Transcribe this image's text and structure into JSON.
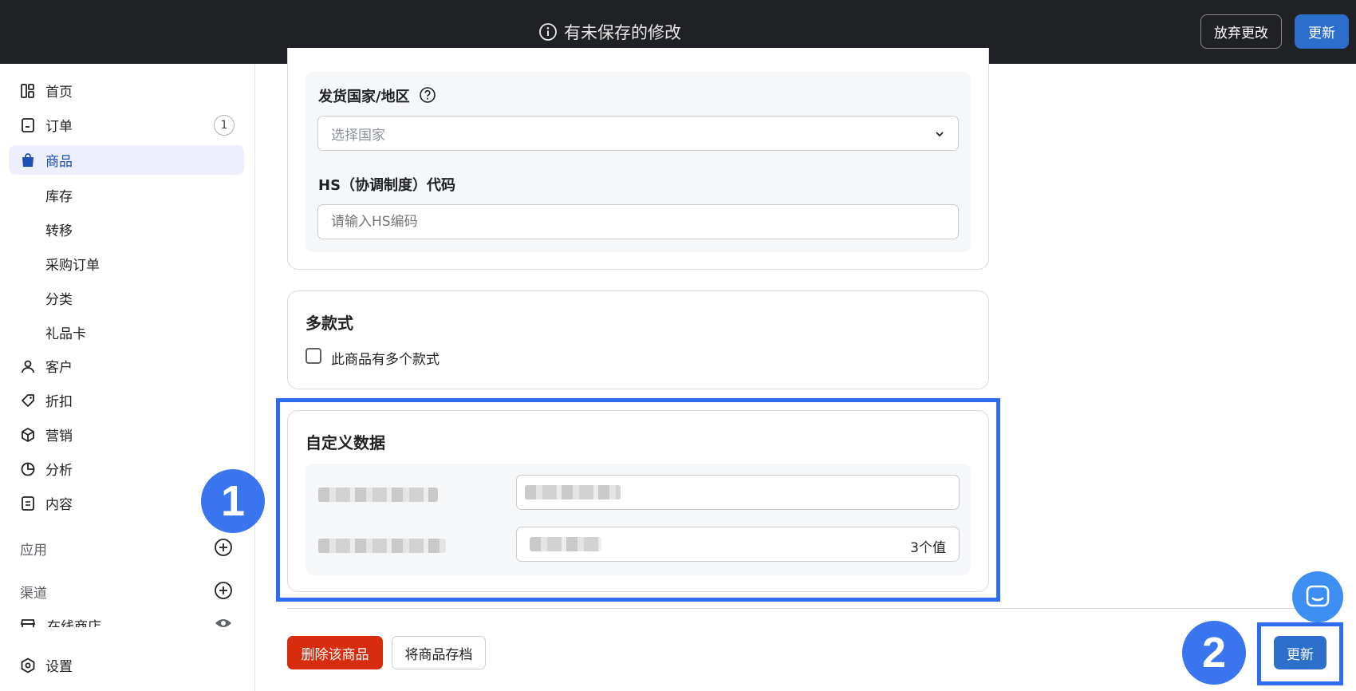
{
  "topbar": {
    "status": "有未保存的修改",
    "discard_label": "放弃更改",
    "update_label": "更新"
  },
  "sidebar": {
    "items": [
      {
        "label": "首页",
        "icon": "home-icon"
      },
      {
        "label": "订单",
        "icon": "orders-icon",
        "badge": "1"
      },
      {
        "label": "商品",
        "icon": "products-icon",
        "active": true
      },
      {
        "label": "客户",
        "icon": "customer-icon"
      },
      {
        "label": "折扣",
        "icon": "tag-icon"
      },
      {
        "label": "营销",
        "icon": "marketing-icon"
      },
      {
        "label": "分析",
        "icon": "analytics-icon"
      },
      {
        "label": "内容",
        "icon": "content-icon"
      }
    ],
    "sub_items": [
      "库存",
      "转移",
      "采购订单",
      "分类",
      "礼品卡"
    ],
    "sections": {
      "apps": "应用",
      "channels": "渠道"
    },
    "online_store": "在线商店",
    "settings": "设置"
  },
  "steps": [
    "1",
    "2"
  ],
  "shipping": {
    "country_label": "发货国家/地区",
    "country_placeholder": "选择国家",
    "hs_label": "HS（协调制度）代码",
    "hs_placeholder": "请输入HS编码"
  },
  "variants": {
    "title": "多款式",
    "checkbox_label": "此商品有多个款式"
  },
  "metafields": {
    "title": "自定义数据",
    "value_count": "3个值"
  },
  "footer": {
    "delete_label": "删除该商品",
    "archive_label": "将商品存档",
    "update_label": "更新"
  },
  "colors": {
    "primary": "#2c6ecb",
    "danger": "#d72c0d",
    "highlight": "#2f6df0",
    "topbar": "#1f2124"
  }
}
